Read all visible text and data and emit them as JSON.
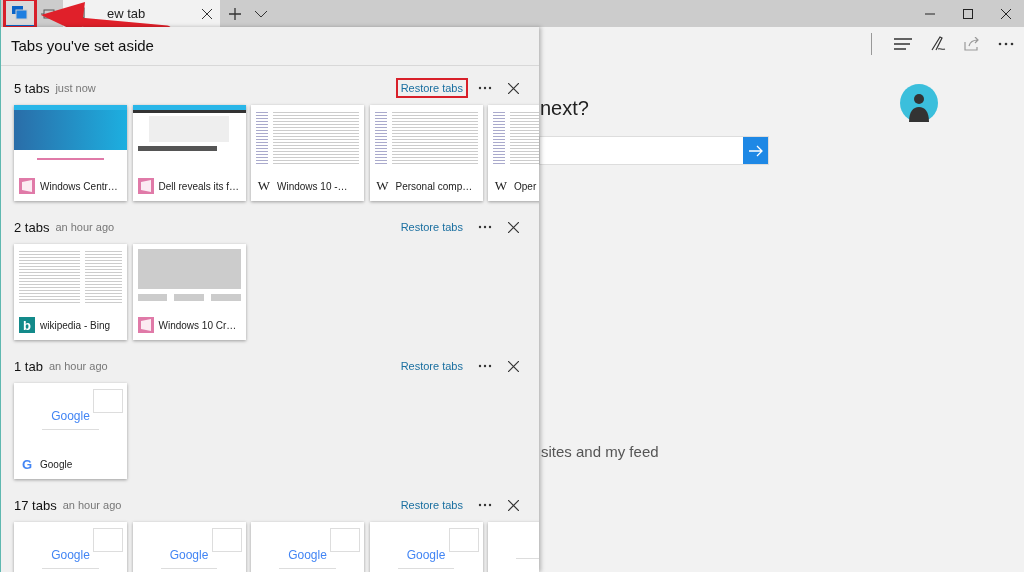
{
  "titlebar": {
    "set_aside_button": {
      "selected": true,
      "highlighted": true
    },
    "tab": {
      "title": "ew tab"
    }
  },
  "annotation_arrow": true,
  "panel": {
    "title": "Tabs you've set aside",
    "groups": [
      {
        "count": "5 tabs",
        "time": "just now",
        "restore": "Restore tabs",
        "highlighted": true,
        "cards": [
          {
            "title": "Windows Centr…",
            "favicon": {
              "kind": "windows-central"
            },
            "kind": "blue-site"
          },
          {
            "title": "Dell reveals its f…",
            "favicon": {
              "kind": "windows-central"
            },
            "kind": "product"
          },
          {
            "title": "Windows 10 -…",
            "favicon": {
              "kind": "wikipedia",
              "char": "W"
            },
            "kind": "article"
          },
          {
            "title": "Personal comp…",
            "favicon": {
              "kind": "wikipedia",
              "char": "W"
            },
            "kind": "article"
          },
          {
            "title": "Oper",
            "favicon": {
              "kind": "wikipedia",
              "char": "W"
            },
            "kind": "article"
          }
        ]
      },
      {
        "count": "2 tabs",
        "time": "an hour ago",
        "restore": "Restore tabs",
        "highlighted": false,
        "cards": [
          {
            "title": "wikipedia - Bing",
            "favicon": {
              "kind": "bing",
              "char": "b"
            },
            "kind": "search-results"
          },
          {
            "title": "Windows 10 Cr…",
            "favicon": {
              "kind": "windows-central"
            },
            "kind": "loading"
          }
        ]
      },
      {
        "count": "1 tab",
        "time": "an hour ago",
        "restore": "Restore tabs",
        "highlighted": false,
        "cards": [
          {
            "title": "Google",
            "favicon": {
              "kind": "google",
              "char": "G"
            },
            "kind": "google",
            "logo": "Google"
          }
        ]
      },
      {
        "count": "17 tabs",
        "time": "an hour ago",
        "restore": "Restore tabs",
        "highlighted": false,
        "cards": [
          {
            "kind": "google",
            "logo": "Google"
          },
          {
            "kind": "google",
            "logo": "Google"
          },
          {
            "kind": "google",
            "logo": "Google"
          },
          {
            "kind": "google",
            "logo": "Google"
          },
          {
            "kind": "google"
          }
        ]
      }
    ]
  },
  "page": {
    "heading": "next?",
    "footer": "sites and my feed"
  }
}
